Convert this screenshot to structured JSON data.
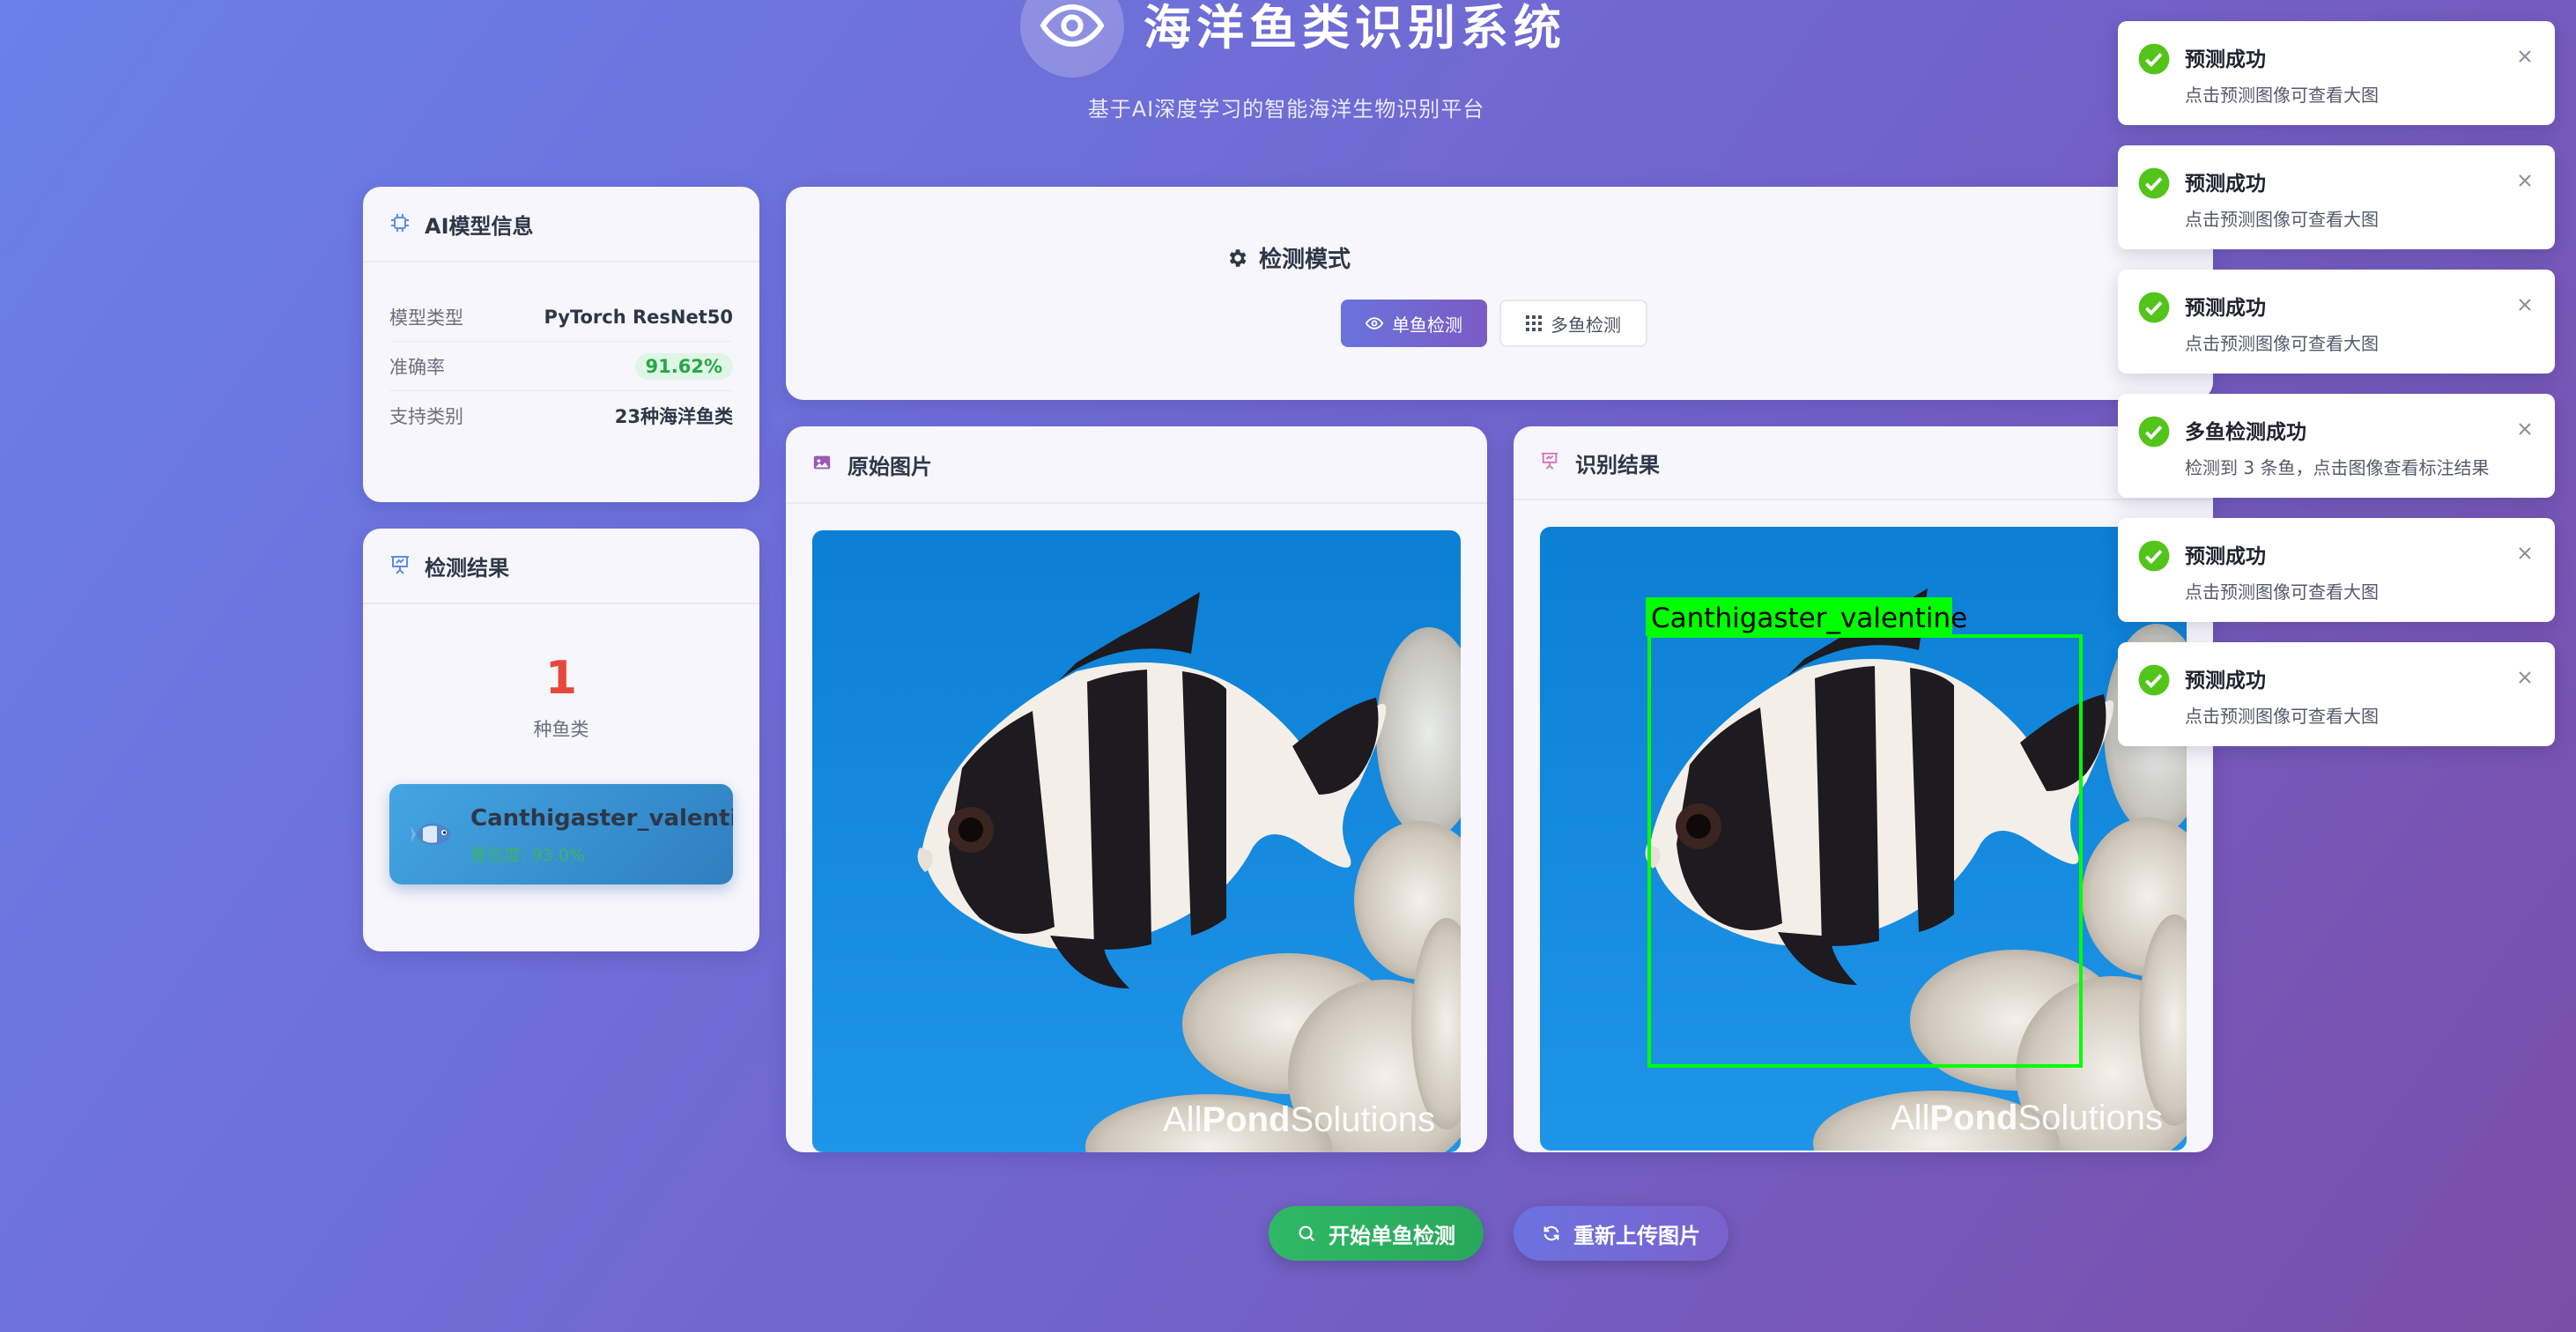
{
  "header": {
    "title": "海洋鱼类识别系统",
    "subtitle": "基于AI深度学习的智能海洋生物识别平台"
  },
  "model_card": {
    "title": "AI模型信息",
    "rows": [
      {
        "key": "模型类型",
        "value": "PyTorch ResNet50"
      },
      {
        "key": "准确率",
        "value": "91.62%"
      },
      {
        "key": "支持类别",
        "value": "23种海洋鱼类"
      }
    ]
  },
  "result_card": {
    "title": "检测结果",
    "count": "1",
    "count_label": "种鱼类",
    "items": [
      {
        "name": "Canthigaster_valentine",
        "confidence": "置信度: 93.0%"
      }
    ]
  },
  "mode_card": {
    "title": "检测模式",
    "buttons": [
      {
        "label": "单鱼检测",
        "active": true
      },
      {
        "label": "多鱼检测",
        "active": false
      }
    ]
  },
  "original_panel": {
    "title": "原始图片",
    "watermark": {
      "pre": "All",
      "mid": "Pond",
      "post": "Solutions"
    }
  },
  "result_panel": {
    "title": "识别结果",
    "box_label": "Canthigaster_valentine",
    "box_color": "#00ff00"
  },
  "actions": {
    "start_label": "开始单鱼检测",
    "reupload_label": "重新上传图片"
  },
  "toasts": [
    {
      "title": "预测成功",
      "message": "点击预测图像可查看大图"
    },
    {
      "title": "预测成功",
      "message": "点击预测图像可查看大图"
    },
    {
      "title": "预测成功",
      "message": "点击预测图像可查看大图"
    },
    {
      "title": "多鱼检测成功",
      "message": "检测到 3 条鱼，点击图像查看标注结果"
    },
    {
      "title": "预测成功",
      "message": "点击预测图像可查看大图"
    },
    {
      "title": "预测成功",
      "message": "点击预测图像可查看大图"
    }
  ],
  "colors": {
    "accent": "#6a73dc",
    "success": "#3bbf4d",
    "count_red": "#e8473c",
    "start_green": "#2db864",
    "reupload_blue": "#6b72e0"
  },
  "icons": {
    "header": "eye-icon",
    "model": "chip-icon",
    "result": "presentation-icon",
    "mode": "gear-icon",
    "single": "eye-icon",
    "multi": "grid-icon",
    "original": "image-icon",
    "start": "search-icon",
    "reupload": "refresh-icon",
    "toast_ok": "check-circle-icon",
    "toast_close": "close-icon"
  }
}
